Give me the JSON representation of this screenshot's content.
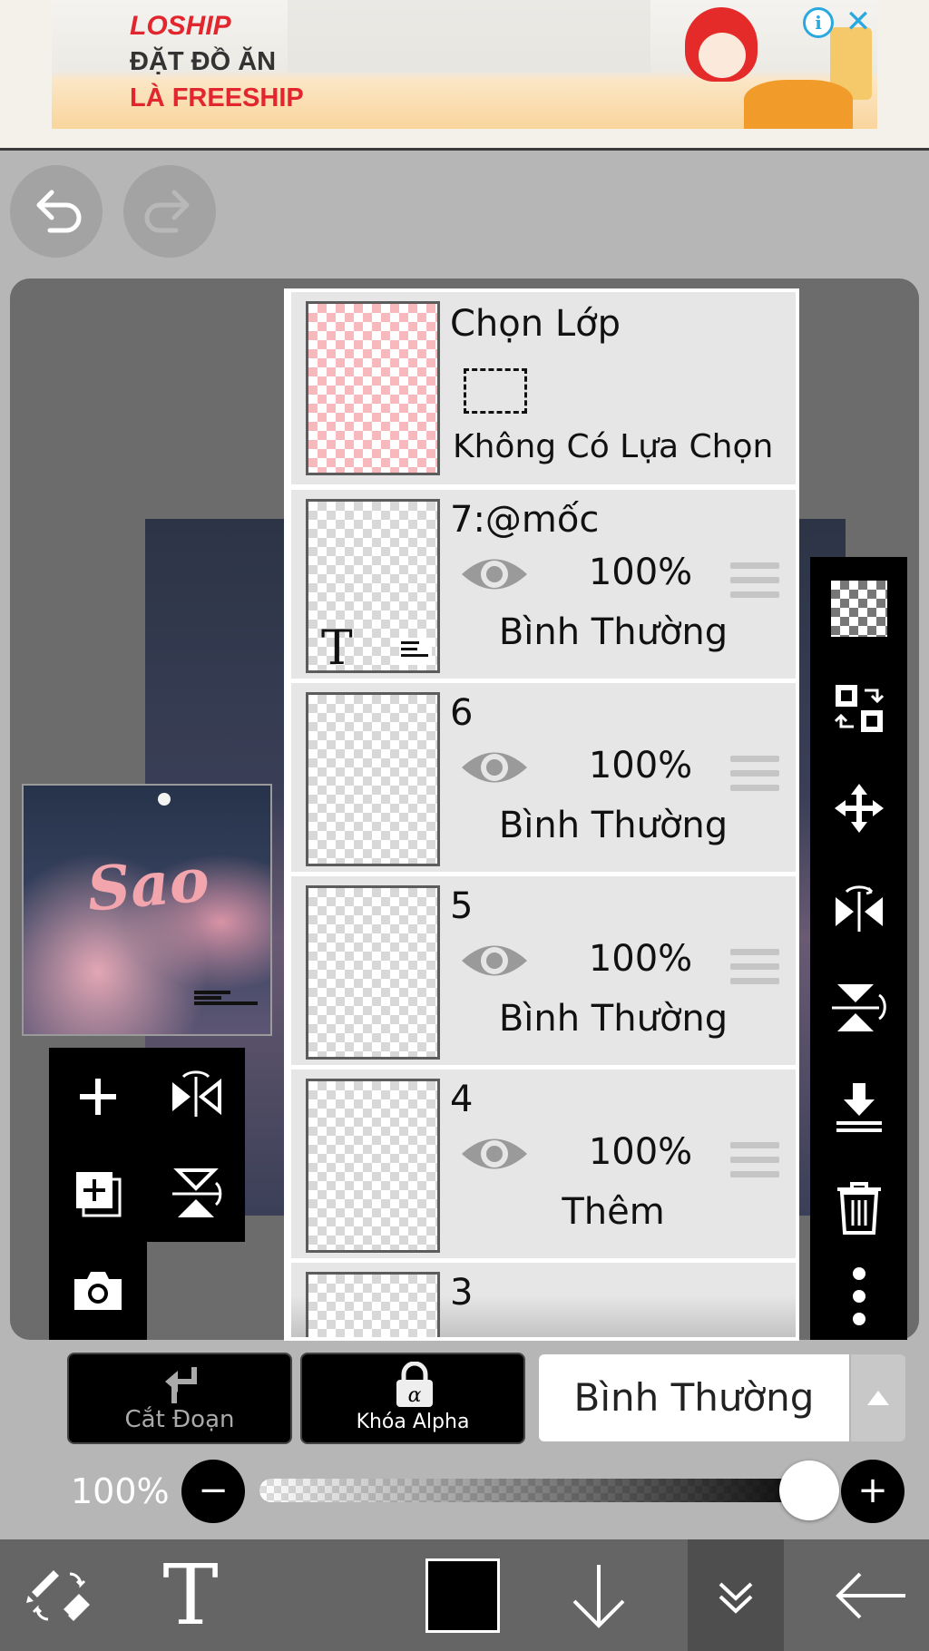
{
  "ad": {
    "brand": "LOSHIP",
    "line1": "ĐẶT ĐỒ ĂN",
    "line2": "LÀ FREESHIP",
    "info_icon": "i",
    "close_icon": "✕"
  },
  "layer_panel": {
    "selection_row": {
      "title": "Chọn Lớp",
      "subtitle": "Không Có Lựa Chọn"
    },
    "layers": [
      {
        "name": "7:@mốc",
        "opacity": "100%",
        "blend": "Bình Thường",
        "visible": true,
        "thumb_letter": "T"
      },
      {
        "name": "6",
        "opacity": "100%",
        "blend": "Bình Thường",
        "visible": true
      },
      {
        "name": "5",
        "opacity": "100%",
        "blend": "Bình Thường",
        "visible": true
      },
      {
        "name": "4",
        "opacity": "100%",
        "blend": "Thêm",
        "visible": true
      },
      {
        "name": "3"
      }
    ]
  },
  "canvas": {
    "thumb_text": "Sao"
  },
  "controls": {
    "clipping_label": "Cắt Đoạn",
    "alpha_lock_label": "Khóa Alpha",
    "blend_mode": "Bình Thường",
    "opacity_label": "100%",
    "opacity_value": 1.0,
    "minus": "−",
    "plus": "+"
  },
  "toolbar": {
    "text_tool": "T"
  },
  "colors": {
    "accent_ad_red": "#e1262d",
    "current_color": "#000000"
  },
  "icons": [
    "undo-icon",
    "redo-icon",
    "plus-icon",
    "flip-horizontal-icon",
    "add-layer-icon",
    "flip-vertical-icon",
    "camera-icon",
    "checker-icon",
    "transform-icon",
    "move-icon",
    "merge-down-icon",
    "trash-icon",
    "more-icon",
    "eye-icon",
    "brush-eraser-icon",
    "down-arrow-icon",
    "double-chevron-icon",
    "back-arrow-icon"
  ]
}
